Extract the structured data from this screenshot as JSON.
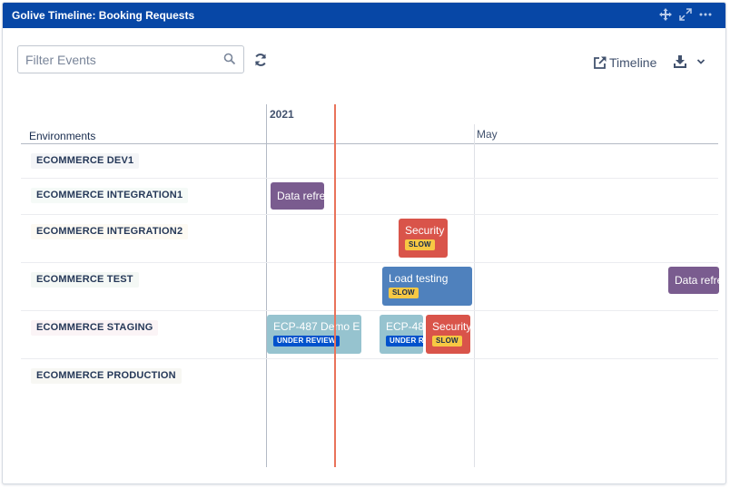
{
  "window": {
    "title": "Golive Timeline: Booking Requests",
    "icons": [
      "move-icon",
      "expand-icon",
      "more-icon"
    ]
  },
  "toolbar": {
    "search_placeholder": "Filter Events",
    "search_value": "",
    "timeline_label": "Timeline"
  },
  "timeline": {
    "year": "2021",
    "month": "May",
    "environments_header": "Environments"
  },
  "environments": [
    {
      "name": "ECOMMERCE DEV1",
      "tag_color": "#f4f5f7"
    },
    {
      "name": "ECOMMERCE INTEGRATION1",
      "tag_color": "#f5faf7"
    },
    {
      "name": "ECOMMERCE INTEGRATION2",
      "tag_color": "#fdfaf3"
    },
    {
      "name": "ECOMMERCE TEST",
      "tag_color": "#f4f8f5"
    },
    {
      "name": "ECOMMERCE STAGING",
      "tag_color": "#fbf4f6"
    },
    {
      "name": "ECOMMERCE PRODUCTION",
      "tag_color": "#f7f7f3"
    }
  ],
  "events": [
    {
      "label": "Data refresh",
      "badge": "",
      "color": "#7a5c8f",
      "environment": "ECOMMERCE INTEGRATION1"
    },
    {
      "label": "Security",
      "badge": "SLOW",
      "color": "#d9544a",
      "environment": "ECOMMERCE INTEGRATION2"
    },
    {
      "label": "Load testing",
      "badge": "SLOW",
      "color": "#4f81bd",
      "environment": "ECOMMERCE TEST"
    },
    {
      "label": "Data refresh",
      "badge": "",
      "color": "#7a5c8f",
      "environment": "ECOMMERCE TEST"
    },
    {
      "label": "ECP-487 Demo E",
      "badge": "UNDER REVIEW",
      "color": "#96c3cf",
      "environment": "ECOMMERCE STAGING"
    },
    {
      "label": "ECP-48",
      "badge": "UNDER REVIEW",
      "color": "#96c3cf",
      "environment": "ECOMMERCE STAGING"
    },
    {
      "label": "Security",
      "badge": "SLOW",
      "color": "#d9544a",
      "environment": "ECOMMERCE STAGING"
    }
  ],
  "colors": {
    "titlebar": "#0747a6",
    "today_line": "#e9735b",
    "badge_slow": "#f7c843",
    "badge_review": "#0052cc"
  }
}
